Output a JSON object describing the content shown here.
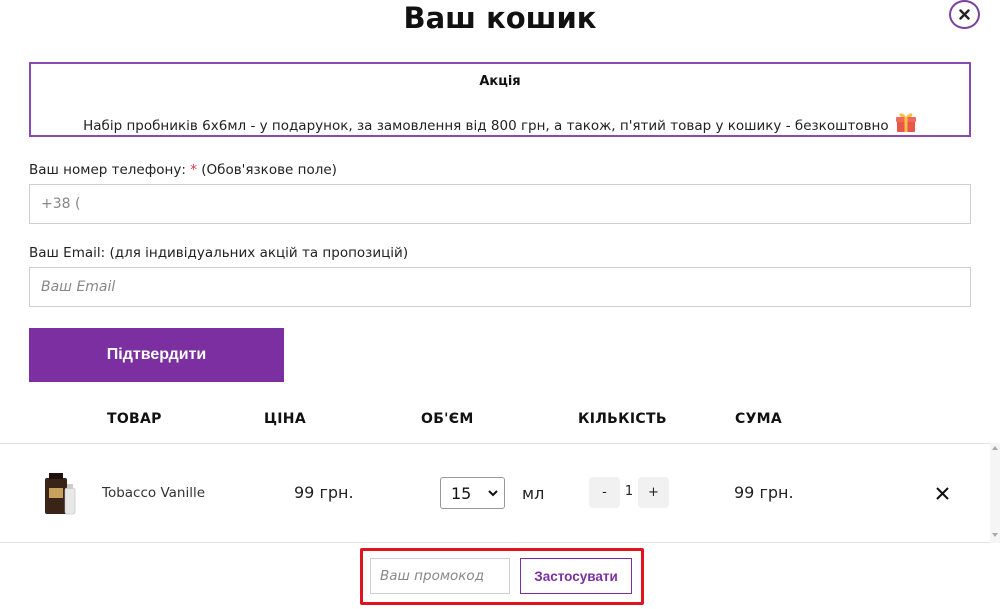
{
  "header": {
    "title": "Ваш кошик",
    "close_icon": "close-icon"
  },
  "promo": {
    "title": "Акція",
    "text": "Набір пробників 6х6мл - у подарунок, за замовлення від 800 грн, а також, п'ятий товар у кошику - безкоштовно",
    "icon": "gift-icon"
  },
  "form": {
    "phone_label": "Ваш номер телефону:",
    "required_mark": "*",
    "phone_note": "(Обов'язкове поле)",
    "phone_placeholder": "+38 (",
    "email_label": "Ваш Email: (для індивідуальних акцій та пропозицій)",
    "email_placeholder": "Ваш Email",
    "confirm_label": "Підтвердити"
  },
  "table": {
    "headers": [
      "Товар",
      "Ціна",
      "Об'єм",
      "Кількість",
      "Сума"
    ],
    "rows": [
      {
        "name": "Tobacco Vanille",
        "price": "99 грн.",
        "volume": "15",
        "unit": "мл",
        "qty": "1",
        "qty_minus": "-",
        "qty_plus": "+",
        "sum": "99 грн."
      }
    ]
  },
  "promocode": {
    "placeholder": "Ваш промокод",
    "apply_label": "Застосувати"
  },
  "colors": {
    "accent": "#7b2fa0",
    "promo_border": "#8a4bb0",
    "highlight": "#e0141e"
  }
}
